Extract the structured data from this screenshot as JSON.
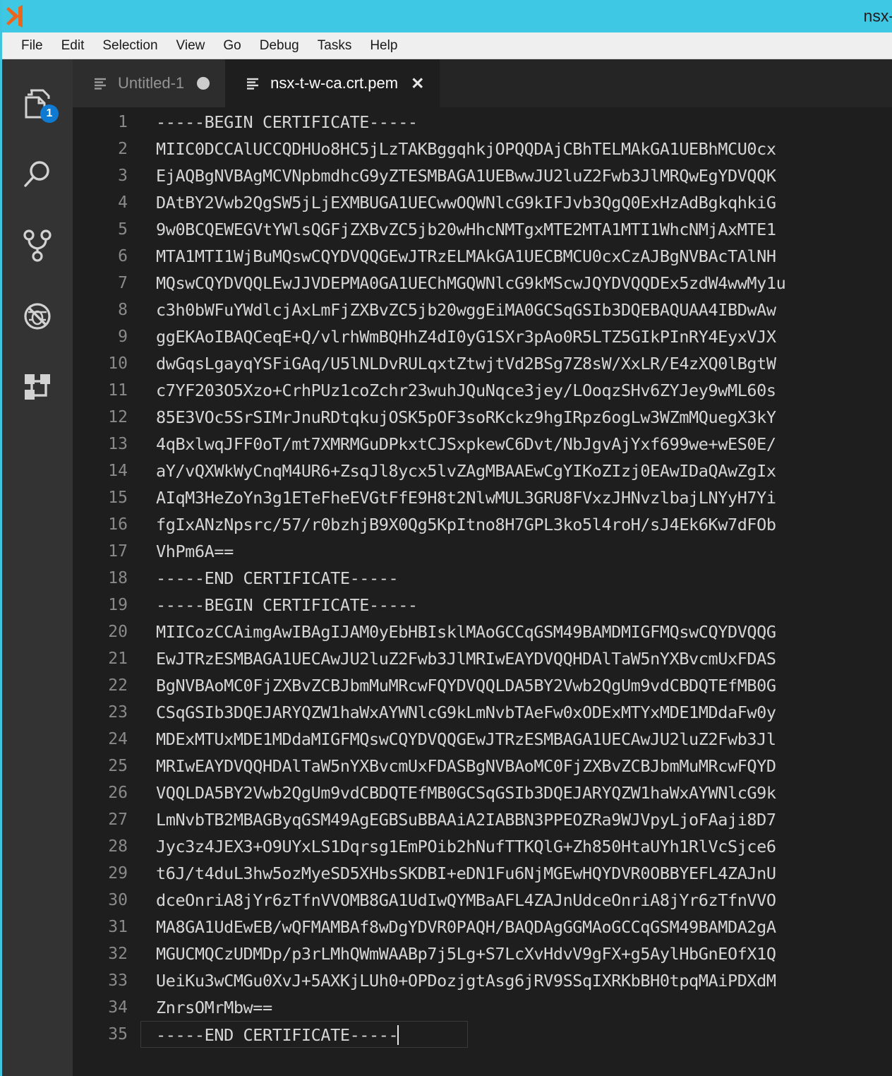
{
  "titlebar": {
    "title": "nsx-",
    "icon": "vscode-logo-icon",
    "bg_color": "#3fc8e4"
  },
  "menubar": {
    "items": [
      {
        "label": "File"
      },
      {
        "label": "Edit"
      },
      {
        "label": "Selection"
      },
      {
        "label": "View"
      },
      {
        "label": "Go"
      },
      {
        "label": "Debug"
      },
      {
        "label": "Tasks"
      },
      {
        "label": "Help"
      }
    ]
  },
  "activitybar": {
    "items": [
      {
        "name": "explorer",
        "icon": "files-icon",
        "badge": "1"
      },
      {
        "name": "search",
        "icon": "search-icon",
        "badge": ""
      },
      {
        "name": "source-control",
        "icon": "source-control-branch-icon",
        "badge": ""
      },
      {
        "name": "debug",
        "icon": "debug-bug-icon",
        "badge": ""
      },
      {
        "name": "extensions",
        "icon": "extensions-squares-icon",
        "badge": ""
      }
    ],
    "badge_color": "#0e7ad1"
  },
  "tabs": [
    {
      "label": "Untitled-1",
      "active": false,
      "dirty": true,
      "closable": false
    },
    {
      "label": "nsx-t-w-ca.crt.pem",
      "active": true,
      "dirty": false,
      "closable": true,
      "close_glyph": "✕"
    }
  ],
  "editor": {
    "file": "nsx-t-w-ca.crt.pem",
    "cursor_line": 35,
    "lines": [
      {
        "n": "1",
        "text": "-----BEGIN CERTIFICATE-----"
      },
      {
        "n": "2",
        "text": "MIIC0DCCAlUCCQDHUo8HC5jLzTAKBggqhkjOPQQDAjCBhTELMAkGA1UEBhMCU0cx"
      },
      {
        "n": "3",
        "text": "EjAQBgNVBAgMCVNpbmdhcG9yZTESMBAGA1UEBwwJU2luZ2Fwb3JlMRQwEgYDVQQK"
      },
      {
        "n": "4",
        "text": "DAtBY2Vwb2QgSW5jLjEXMBUGA1UECwwOQWNlcG9kIFJvb3QgQ0ExHzAdBgkqhkiG"
      },
      {
        "n": "5",
        "text": "9w0BCQEWEGVtYWlsQGFjZXBvZC5jb20wHhcNMTgxMTE2MTA1MTI1WhcNMjAxMTE1"
      },
      {
        "n": "6",
        "text": "MTA1MTI1WjBuMQswCQYDVQQGEwJTRzELMAkGA1UECBMCU0cxCzAJBgNVBAcTAlNH"
      },
      {
        "n": "7",
        "text": "MQswCQYDVQQLEwJJVDEPMA0GA1UEChMGQWNlcG9kMScwJQYDVQQDEx5zdW4wwMy1u"
      },
      {
        "n": "8",
        "text": "c3h0bWFuYWdlcjAxLmFjZXBvZC5jb20wggEiMA0GCSqGSIb3DQEBAQUAA4IBDwAw"
      },
      {
        "n": "9",
        "text": "ggEKAoIBAQCeqE+Q/vlrhWmBQHhZ4dI0yG1SXr3pAo0R5LTZ5GIkPInRY4EyxVJX"
      },
      {
        "n": "10",
        "text": "dwGqsLgayqYSFiGAq/U5lNLDvRULqxtZtwjtVd2BSg7Z8sW/XxLR/E4zXQ0lBgtW"
      },
      {
        "n": "11",
        "text": "c7YF203O5Xzo+CrhPUz1coZchr23wuhJQuNqce3jey/LOoqzSHv6ZYJey9wML60s"
      },
      {
        "n": "12",
        "text": "85E3VOc5SrSIMrJnuRDtqkujOSK5pOF3soRKckz9hgIRpz6ogLw3WZmMQuegX3kY"
      },
      {
        "n": "13",
        "text": "4qBxlwqJFF0oT/mt7XMRMGuDPkxtCJSxpkewC6Dvt/NbJgvAjYxf699we+wES0E/"
      },
      {
        "n": "14",
        "text": "aY/vQXWkWyCnqM4UR6+ZsqJl8ycx5lvZAgMBAAEwCgYIKoZIzj0EAwIDaQAwZgIx"
      },
      {
        "n": "15",
        "text": "AIqM3HeZoYn3g1ETeFheEVGtFfE9H8t2NlwMUL3GRU8FVxzJHNvzlbajLNYyH7Yi"
      },
      {
        "n": "16",
        "text": "fgIxANzNpsrc/57/r0bzhjB9X0Qg5KpItno8H7GPL3ko5l4roH/sJ4Ek6Kw7dFOb"
      },
      {
        "n": "17",
        "text": "VhPm6A=="
      },
      {
        "n": "18",
        "text": "-----END CERTIFICATE-----"
      },
      {
        "n": "19",
        "text": "-----BEGIN CERTIFICATE-----"
      },
      {
        "n": "20",
        "text": "MIICozCCAimgAwIBAgIJAM0yEbHBIsklMAoGCCqGSM49BAMDMIGFMQswCQYDVQQG"
      },
      {
        "n": "21",
        "text": "EwJTRzESMBAGA1UECAwJU2luZ2Fwb3JlMRIwEAYDVQQHDAlTaW5nYXBvcmUxFDAS"
      },
      {
        "n": "22",
        "text": "BgNVBAoMC0FjZXBvZCBJbmMuMRcwFQYDVQQLDA5BY2Vwb2QgUm9vdCBDQTEfMB0G"
      },
      {
        "n": "23",
        "text": "CSqGSIb3DQEJARYQZW1haWxAYWNlcG9kLmNvbTAeFw0xODExMTYxMDE1MDdaFw0y"
      },
      {
        "n": "24",
        "text": "MDExMTUxMDE1MDdaMIGFMQswCQYDVQQGEwJTRzESMBAGA1UECAwJU2luZ2Fwb3Jl"
      },
      {
        "n": "25",
        "text": "MRIwEAYDVQQHDAlTaW5nYXBvcmUxFDASBgNVBAoMC0FjZXBvZCBJbmMuMRcwFQYD"
      },
      {
        "n": "26",
        "text": "VQQLDA5BY2Vwb2QgUm9vdCBDQTEfMB0GCSqGSIb3DQEJARYQZW1haWxAYWNlcG9k"
      },
      {
        "n": "27",
        "text": "LmNvbTB2MBAGByqGSM49AgEGBSuBBAAiA2IABBN3PPEOZRa9WJVpyLjoFAaji8D7"
      },
      {
        "n": "28",
        "text": "Jyc3z4JEX3+O9UYxLS1Dqrsg1EmPOib2hNufTTKQlG+Zh850HtaUYh1RlVcSjce6"
      },
      {
        "n": "29",
        "text": "t6J/t4duL3hw5ozMyeSD5XHbsSKDBI+eDN1Fu6NjMGEwHQYDVR0OBBYEFL4ZAJnU"
      },
      {
        "n": "30",
        "text": "dceOnriA8jYr6zTfnVVOMB8GA1UdIwQYMBaAFL4ZAJnUdceOnriA8jYr6zTfnVVO"
      },
      {
        "n": "31",
        "text": "MA8GA1UdEwEB/wQFMAMBAf8wDgYDVR0PAQH/BAQDAgGGMAoGCCqGSM49BAMDA2gA"
      },
      {
        "n": "32",
        "text": "MGUCMQCzUDMDp/p3rLMhQWmWAABp7j5Lg+S7LcXvHdvV9gFX+g5AylHbGnEOfX1Q"
      },
      {
        "n": "33",
        "text": "UeiKu3wCMGu0XvJ+5AXKjLUh0+OPDozjgtAsg6jRV9SSqIXRKbBH0tpqMAiPDXdM"
      },
      {
        "n": "34",
        "text": "ZnrsOMrMbw=="
      },
      {
        "n": "35",
        "text": "-----END CERTIFICATE-----"
      }
    ]
  }
}
